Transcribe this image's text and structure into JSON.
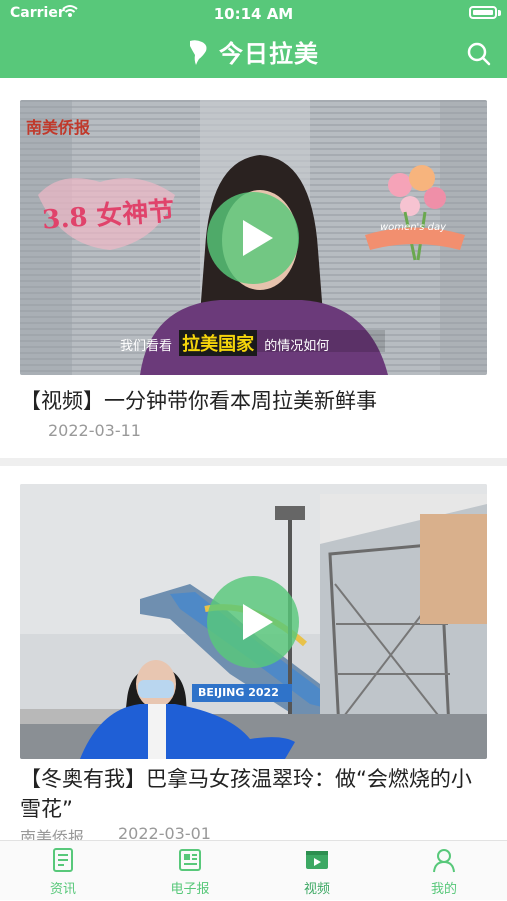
{
  "status_bar": {
    "carrier": "Carrier",
    "time": "10:14 AM"
  },
  "header": {
    "title": "今日拉美",
    "search_icon": "search-icon"
  },
  "colors": {
    "brand_green": "#58c87a",
    "active_green": "#3ca863",
    "date_gray": "#999999"
  },
  "feed": {
    "items": [
      {
        "headline": "【视频】一分钟带你看本周拉美新鲜事",
        "date": "2022-03-11",
        "thumb_caption_normal_1": "我们看看",
        "thumb_caption_highlight": "拉美国家",
        "thumb_caption_normal_2": "的情况如何",
        "thumb_logo": "南美侨报",
        "thumb_banner": "3.8 女神节",
        "thumb_badge": "women's day"
      },
      {
        "headline": "【冬奥有我】巴拿马女孩温翠玲：做“会燃烧的小雪花”",
        "source": "南美侨报",
        "date": "2022-03-01",
        "thumb_sign": "BEIJING 2022"
      }
    ]
  },
  "tabbar": {
    "tabs": [
      {
        "label": "资讯",
        "icon": "news-icon"
      },
      {
        "label": "电子报",
        "icon": "newspaper-icon"
      },
      {
        "label": "视频",
        "icon": "video-icon",
        "active": true
      },
      {
        "label": "我的",
        "icon": "profile-icon"
      }
    ]
  }
}
